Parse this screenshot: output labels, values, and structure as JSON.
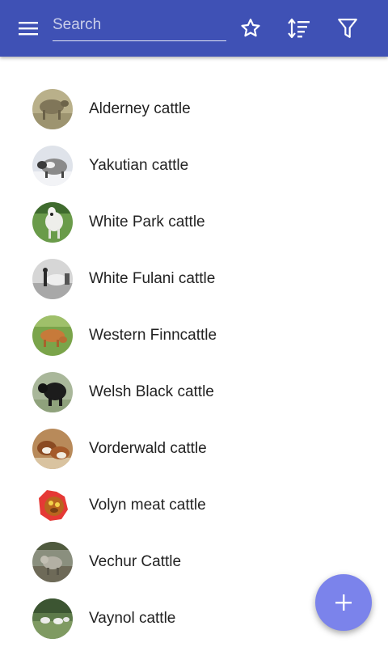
{
  "appbar": {
    "background": "#3f51b5",
    "menu_icon": "hamburger-menu-icon",
    "search": {
      "placeholder": "Search",
      "value": ""
    },
    "actions": [
      {
        "name": "favorites-button",
        "icon": "star-outline-icon"
      },
      {
        "name": "sort-button",
        "icon": "sort-icon"
      },
      {
        "name": "filter-button",
        "icon": "filter-icon"
      }
    ]
  },
  "breeds": [
    {
      "label": "Alderney cattle",
      "photo": "alderney-cattle-photo"
    },
    {
      "label": "Yakutian cattle",
      "photo": "yakutian-cattle-photo"
    },
    {
      "label": "White Park cattle",
      "photo": "white-park-cattle-photo"
    },
    {
      "label": "White Fulani cattle",
      "photo": "white-fulani-cattle-photo"
    },
    {
      "label": "Western Finncattle",
      "photo": "western-finncattle-photo"
    },
    {
      "label": "Welsh Black cattle",
      "photo": "welsh-black-cattle-photo"
    },
    {
      "label": "Vorderwald cattle",
      "photo": "vorderwald-cattle-photo"
    },
    {
      "label": "Volyn meat cattle",
      "photo": "volyn-meat-cattle-photo"
    },
    {
      "label": "Vechur Cattle",
      "photo": "vechur-cattle-photo"
    },
    {
      "label": "Vaynol cattle",
      "photo": "vaynol-cattle-photo"
    }
  ],
  "fab": {
    "icon": "plus-icon",
    "color": "#7b83eb"
  }
}
